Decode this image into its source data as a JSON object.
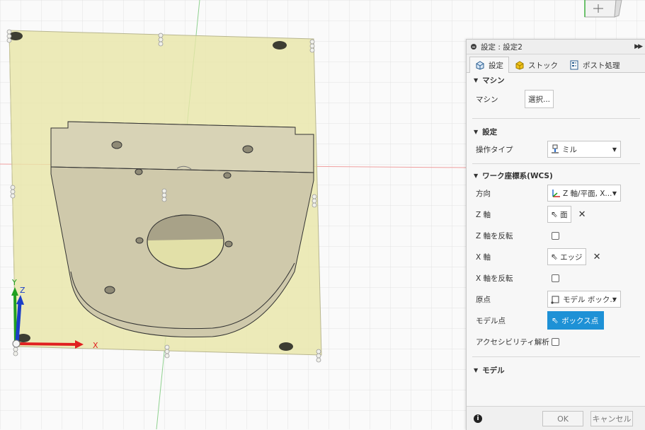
{
  "viewport": {
    "axis_x_label": "X",
    "axis_y_label": "Y",
    "axis_z_label": "Z",
    "colors": {
      "stock": "#e6e4a4",
      "part": "#d6cfae",
      "axis_x": "#e02020",
      "axis_y": "#20a020",
      "axis_z": "#1a3ec8",
      "grid": "#dcdcdc"
    }
  },
  "panel": {
    "title": "設定 : 設定2",
    "expand_icon": "double-chevron-right-icon",
    "tabs": [
      {
        "label": "設定",
        "icon": "setup-icon",
        "active": true
      },
      {
        "label": "ストック",
        "icon": "stock-box-icon",
        "active": false
      },
      {
        "label": "ポスト処理",
        "icon": "post-process-icon",
        "active": false
      }
    ],
    "sections": {
      "machine": {
        "title": "マシン",
        "machine_label": "マシン",
        "select_button": "選択..."
      },
      "setup": {
        "title": "設定",
        "operation_type_label": "操作タイプ",
        "operation_type_value": "ミル"
      },
      "wcs": {
        "title": "ワーク座標系(WCS)",
        "orientation_label": "方向",
        "orientation_value": "Z 軸/平面, X...",
        "z_axis_label": "Z 軸",
        "z_axis_value": "面",
        "flip_z_label": "Z 軸を反転",
        "x_axis_label": "X 軸",
        "x_axis_value": "エッジ",
        "flip_x_label": "X 軸を反転",
        "origin_label": "原点",
        "origin_value": "モデル ボック...",
        "model_point_label": "モデル点",
        "model_point_value": "ボックス点",
        "accessibility_label": "アクセシビリティ解析"
      },
      "model": {
        "title": "モデル"
      }
    },
    "footer": {
      "ok": "OK",
      "cancel": "キャンセル"
    }
  }
}
